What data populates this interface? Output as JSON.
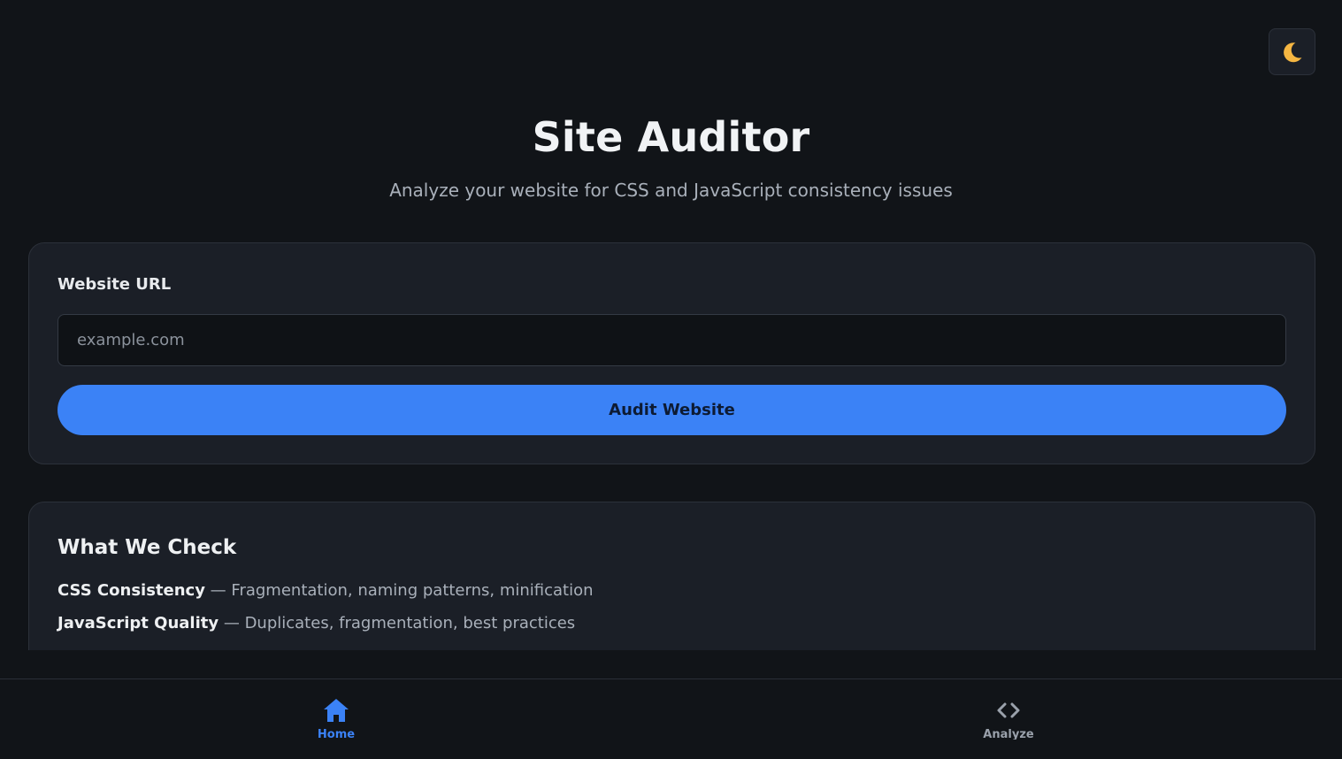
{
  "header": {
    "title": "Site Auditor",
    "subtitle": "Analyze your website for CSS and JavaScript consistency issues",
    "theme_toggle_icon": "moon-icon"
  },
  "form": {
    "label": "Website URL",
    "url_value": "",
    "url_placeholder": "example.com",
    "submit_label": "Audit Website"
  },
  "checks": {
    "heading": "What We Check",
    "items": [
      {
        "name": "CSS Consistency",
        "separator": " — ",
        "description": "Fragmentation, naming patterns, minification"
      },
      {
        "name": "JavaScript Quality",
        "separator": " — ",
        "description": "Duplicates, fragmentation, best practices"
      }
    ]
  },
  "bottom_nav": {
    "items": [
      {
        "label": "Home",
        "icon": "home-icon",
        "active": true
      },
      {
        "label": "Analyze",
        "icon": "code-icon",
        "active": false
      }
    ]
  },
  "colors": {
    "background": "#111418",
    "card": "#1b1f27",
    "accent": "#3b82f6",
    "moon": "#f5b642"
  }
}
